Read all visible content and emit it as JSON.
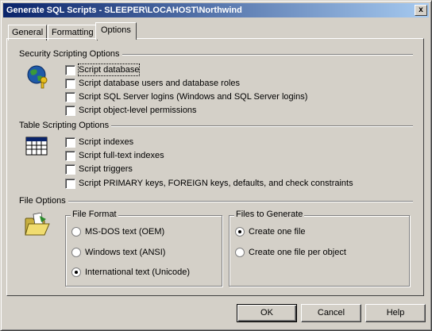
{
  "window": {
    "title": "Generate SQL Scripts - SLEEPER\\LOCAHOST\\Northwind",
    "close_label": "x"
  },
  "tabs": [
    {
      "label": "General",
      "active": false
    },
    {
      "label": "Formatting",
      "active": false
    },
    {
      "label": "Options",
      "active": true
    }
  ],
  "security": {
    "title": "Security Scripting Options",
    "icon": "globe-key-icon",
    "options": [
      {
        "label": "Script database",
        "checked": false
      },
      {
        "label": "Script database users and database roles",
        "checked": false
      },
      {
        "label": "Script SQL Server logins (Windows and SQL Server logins)",
        "checked": false
      },
      {
        "label": "Script object-level permissions",
        "checked": false
      }
    ]
  },
  "table": {
    "title": "Table Scripting Options",
    "icon": "table-grid-icon",
    "options": [
      {
        "label": "Script indexes",
        "checked": false
      },
      {
        "label": "Script full-text indexes",
        "checked": false
      },
      {
        "label": "Script triggers",
        "checked": false
      },
      {
        "label": "Script PRIMARY keys, FOREIGN keys, defaults, and check constraints",
        "checked": false
      }
    ]
  },
  "file": {
    "title": "File Options",
    "icon": "open-folder-icon",
    "format": {
      "title": "File Format",
      "options": [
        {
          "label": "MS-DOS text (OEM)",
          "selected": false
        },
        {
          "label": "Windows text (ANSI)",
          "selected": false
        },
        {
          "label": "International text (Unicode)",
          "selected": true
        }
      ]
    },
    "generate": {
      "title": "Files to Generate",
      "options": [
        {
          "label": "Create one file",
          "selected": true
        },
        {
          "label": "Create one file per object",
          "selected": false
        }
      ]
    }
  },
  "buttons": {
    "ok": "OK",
    "cancel": "Cancel",
    "help": "Help"
  },
  "colors": {
    "face": "#d4d0c8",
    "title_start": "#0a246a",
    "title_end": "#a6caf0"
  }
}
